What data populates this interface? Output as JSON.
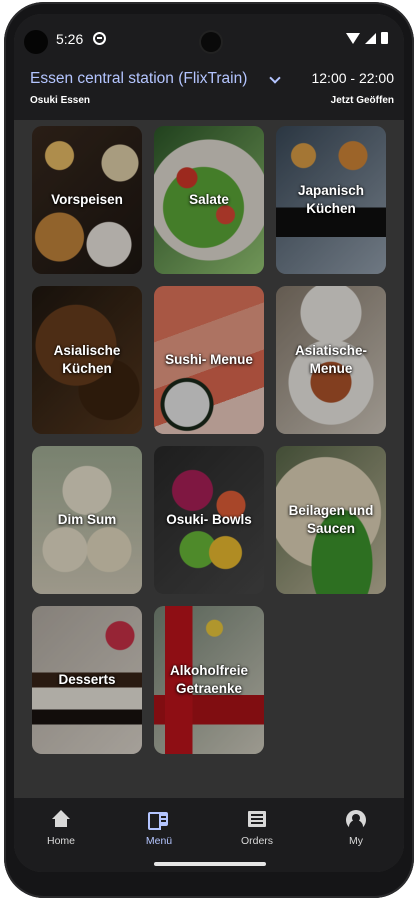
{
  "status_bar": {
    "time": "5:26",
    "icons": [
      "app-notification-icon",
      "wifi-icon",
      "signal-icon",
      "battery-icon"
    ]
  },
  "header": {
    "station": "Essen central station (FlixTrain)",
    "subtitle": "Osuki Essen",
    "hours": "12:00 - 22:00",
    "open_status": "Jetzt Geöffen"
  },
  "categories": [
    {
      "label": "Vorspeisen"
    },
    {
      "label": "Salate"
    },
    {
      "label": "Japanisch Küchen"
    },
    {
      "label": "Asialische Küchen"
    },
    {
      "label": "Sushi- Menue"
    },
    {
      "label": "Asiatische- Menue"
    },
    {
      "label": "Dim Sum"
    },
    {
      "label": "Osuki- Bowls"
    },
    {
      "label": "Beilagen und Saucen"
    },
    {
      "label": "Desserts"
    },
    {
      "label": "Alkoholfreie Getraenke"
    }
  ],
  "nav": {
    "home": "Home",
    "menu": "Menü",
    "orders": "Orders",
    "my": "My"
  },
  "colors": {
    "accent": "#b4c5ff",
    "background": "#323232",
    "bar": "#1c1c1e"
  }
}
